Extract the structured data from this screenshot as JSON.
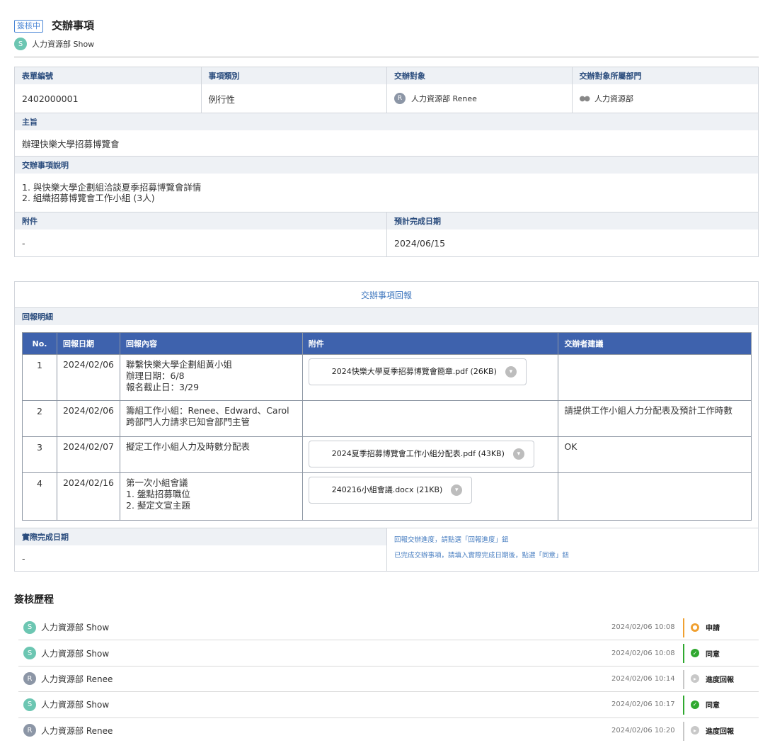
{
  "header": {
    "status_tag": "簽核中",
    "title": "交辦事項",
    "creator_initial": "S",
    "creator": "人力資源部 Show"
  },
  "form": {
    "labels": {
      "form_no": "表單編號",
      "category": "事項類別",
      "assignee": "交辦對象",
      "assignee_dept": "交辦對象所屬部門",
      "subject": "主旨",
      "description": "交辦事項說明",
      "attachment": "附件",
      "due_date": "預計完成日期"
    },
    "form_no": "2402000001",
    "category": "例行性",
    "assignee_initial": "R",
    "assignee": "人力資源部 Renee",
    "assignee_dept": "人力資源部",
    "subject": "辦理快樂大學招募博覽會",
    "description_lines": [
      "1. 與快樂大學企劃組洽談夏季招募博覽會詳情",
      "2. 組織招募博覽會工作小組 (3人)"
    ],
    "attachment": "-",
    "due_date": "2024/06/15"
  },
  "report": {
    "title": "交辦事項回報",
    "subtitle": "回報明細",
    "columns": [
      "No.",
      "回報日期",
      "回報內容",
      "附件",
      "交辦者建議"
    ],
    "rows": [
      {
        "no": "1",
        "date": "2024/02/06",
        "content": [
          "聯繫快樂大學企劃組黃小姐",
          "辦理日期：6/8",
          "報名截止日：3/29"
        ],
        "file": "2024快樂大學夏季招募博覽會簡章.pdf (26KB)",
        "advice": ""
      },
      {
        "no": "2",
        "date": "2024/02/06",
        "content": [
          "籌組工作小組：Renee、Edward、Carol",
          "跨部門人力請求已知會部門主管"
        ],
        "file": "",
        "advice": "請提供工作小組人力分配表及預計工作時數"
      },
      {
        "no": "3",
        "date": "2024/02/07",
        "content": [
          "擬定工作小組人力及時數分配表"
        ],
        "file": "2024夏季招募博覽會工作小組分配表.pdf (43KB)",
        "advice": "OK"
      },
      {
        "no": "4",
        "date": "2024/02/16",
        "content": [
          "第一次小組會議",
          "1. 盤點招募職位",
          "2. 擬定文宣主題"
        ],
        "file": "240216小組會議.docx (21KB)",
        "advice": ""
      }
    ],
    "actual_date_label": "實際完成日期",
    "actual_date": "-",
    "hints": [
      "回報交辦進度，請點選「回報進度」鈕",
      "已完成交辦事項，請填入實際完成日期後，點選「同意」鈕"
    ]
  },
  "history": {
    "title": "簽核歷程",
    "entries": [
      {
        "initial": "S",
        "person": "人力資源部 Show",
        "time": "2024/02/06 10:08",
        "action": "申請",
        "status_color": "#f0a030"
      },
      {
        "initial": "S",
        "person": "人力資源部 Show",
        "time": "2024/02/06 10:08",
        "action": "同意",
        "status_color": "#2fa82f"
      },
      {
        "initial": "R",
        "person": "人力資源部 Renee",
        "time": "2024/02/06 10:14",
        "action": "進度回報",
        "status_color": "#c8c8c8"
      },
      {
        "initial": "S",
        "person": "人力資源部 Show",
        "time": "2024/02/06 10:17",
        "action": "同意",
        "status_color": "#2fa82f"
      },
      {
        "initial": "R",
        "person": "人力資源部 Renee",
        "time": "2024/02/06 10:20",
        "action": "進度回報",
        "status_color": "#c8c8c8"
      }
    ]
  }
}
